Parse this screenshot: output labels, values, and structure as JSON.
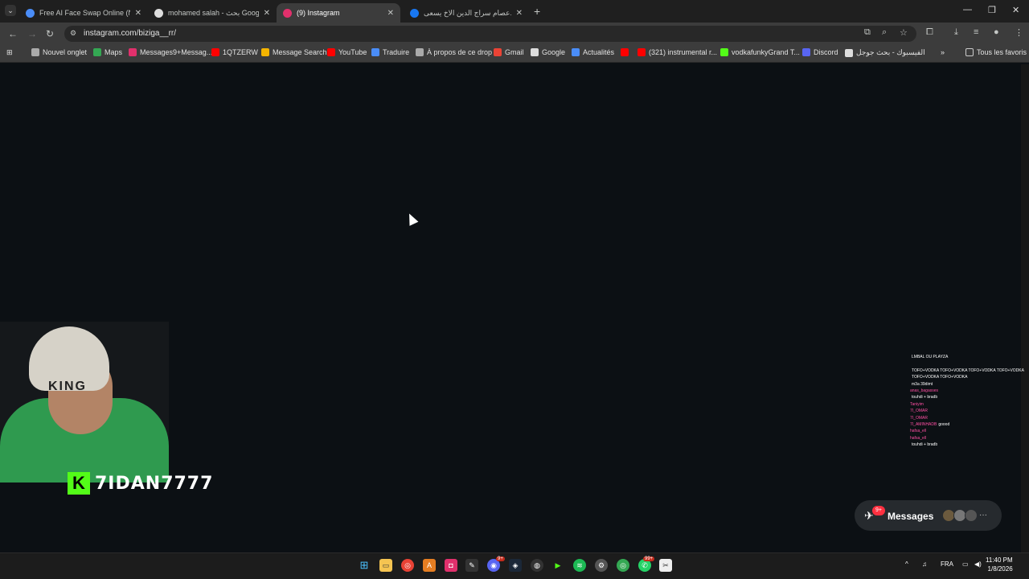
{
  "tabs": [
    {
      "label": "Free AI Face Swap Online (No S",
      "icon": "ai-site-icon",
      "color": "#4a8df8",
      "active": false
    },
    {
      "label": "mohamed salah - بحث Google",
      "icon": "google-icon",
      "color": "#dddddd",
      "active": false
    },
    {
      "label": "(9) Instagram",
      "icon": "instagram-icon",
      "color": "#e1306c",
      "active": true
    },
    {
      "label": "عصام سراج الدين الاخ يسعى... - ||",
      "icon": "facebook-icon",
      "color": "#1877f2",
      "active": false
    }
  ],
  "address_bar": {
    "url": "instagram.com/biziga__rr/"
  },
  "bookmarks": [
    {
      "label": "Nouvel onglet",
      "icon": "globe-icon",
      "color": "#aaaaaa"
    },
    {
      "label": "Maps",
      "icon": "maps-icon",
      "color": "#34a853"
    },
    {
      "label": "Messages9+Messag...",
      "icon": "instagram-icon",
      "color": "#e1306c"
    },
    {
      "label": "1QTZERW",
      "icon": "youtube-icon",
      "color": "#ff0000"
    },
    {
      "label": "Message Search",
      "icon": "analytics-icon",
      "color": "#f4b400"
    },
    {
      "label": "YouTube",
      "icon": "youtube-icon",
      "color": "#ff0000"
    },
    {
      "label": "Traduire",
      "icon": "translate-icon",
      "color": "#4a8df8"
    },
    {
      "label": "À propos de ce drop",
      "icon": "globe-icon",
      "color": "#aaaaaa"
    },
    {
      "label": "Gmail",
      "icon": "gmail-icon",
      "color": "#ea4335"
    },
    {
      "label": "Google",
      "icon": "google-icon",
      "color": "#dddddd"
    },
    {
      "label": "Actualités",
      "icon": "news-icon",
      "color": "#4a8df8"
    },
    {
      "label": "",
      "icon": "youtube-icon",
      "color": "#ff0000"
    },
    {
      "label": "(321) instrumental r...",
      "icon": "youtube-icon",
      "color": "#ff0000"
    },
    {
      "label": "vodkafunkyGrand T...",
      "icon": "kick-icon",
      "color": "#53fc18"
    },
    {
      "label": "Discord",
      "icon": "discord-icon",
      "color": "#5865f2"
    },
    {
      "label": "الفيسبوك - بحث جوجل",
      "icon": "google-icon",
      "color": "#dddddd"
    }
  ],
  "all_bookmarks_label": "Tous les favoris",
  "overlay": {
    "streamer_name": "7IDAN7777",
    "beanie_text": "KING"
  },
  "chat": [
    {
      "user": "",
      "text": "LMBAL OU PLAYZA"
    },
    {
      "user": "",
      "text": ""
    },
    {
      "user": "",
      "text": "TOFO+VODKA TOFO+VODKA TOFO+VODKA TOFO+VODKA"
    },
    {
      "user": "",
      "text": "TOFO+VODKA TOFO+VODKA"
    },
    {
      "user": "",
      "text": "m3a 39dimt"
    },
    {
      "user": "anas_bagasses",
      "text": ""
    },
    {
      "user": "",
      "text": "touhdi + bradb"
    },
    {
      "user": "Taniyim",
      "text": ""
    },
    {
      "user": "7I_OMAR",
      "text": ""
    },
    {
      "user": "7I_OMAR",
      "text": ""
    },
    {
      "user": "7I_AMINHADB",
      "text": "goood"
    },
    {
      "user": "hafsa_ell",
      "text": ""
    },
    {
      "user": "hafsa_ell",
      "text": ""
    },
    {
      "user": "",
      "text": "touhdi + bradb"
    },
    {
      "user": "",
      "text": ""
    }
  ],
  "messages_widget": {
    "label": "Messages",
    "badge": "9+"
  },
  "taskbar": {
    "discord_badge": "9+",
    "whatsapp_badge": "99+",
    "language": "FRA",
    "time": "11:40 PM",
    "date": "1/8/2026"
  }
}
